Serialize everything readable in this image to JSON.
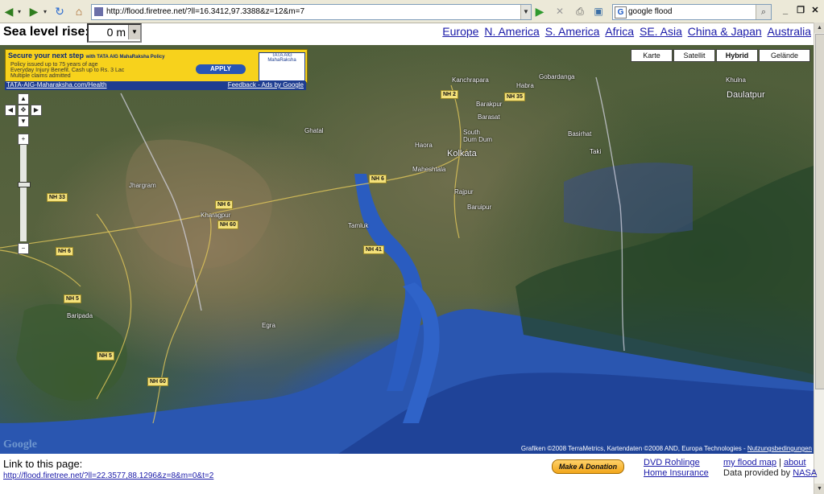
{
  "browser": {
    "url": "http://flood.firetree.net/?ll=16.3412,97.3388&z=12&m=7",
    "search_engine": "G",
    "search_query": "google flood",
    "icons": [
      "back-arrow-icon",
      "forward-arrow-icon",
      "dropdown-icon",
      "refresh-icon",
      "home-icon",
      "go-icon",
      "stop-icon",
      "print-icon",
      "screenshot-icon",
      "search-icon",
      "minimize-icon",
      "restore-icon",
      "close-icon"
    ]
  },
  "header": {
    "sea_level_label": "Sea level rise:",
    "sea_level_value": "0 m",
    "regions": [
      "Europe",
      "N. America",
      "S. America",
      "Africa",
      "SE. Asia",
      "China & Japan",
      "Australia"
    ]
  },
  "ad": {
    "headline": "Secure your next step",
    "headline_small": "with TATA AIG MahaRaksha Policy",
    "bullets": [
      "Policy issued up to 75 years of age",
      "Everyday Injury Benefit. Cash up to Rs. 3 Lac",
      "Multiple claims admitted"
    ],
    "apply": "APPLY",
    "logo": "TATA AIG MahaRaksha",
    "source_link": "TATA-AIG-Maharaksha.com/Health",
    "feedback": "Feedback - Ads by Google"
  },
  "map": {
    "map_types": [
      "Karte",
      "Satellit",
      "Hybrid",
      "Gelände"
    ],
    "active_type": "Hybrid",
    "copyright_text": "Grafiken ©2008 TerraMetrics, Kartendaten ©2008 AND, Europa Technologies -",
    "terms_link": "Nutzungsbedingungen",
    "logo": "Google",
    "zoom_level_fraction": 0.6,
    "places": [
      "Kanchrapara",
      "Habra",
      "Gobardanga",
      "Khulna",
      "Daulatpur",
      "Barakpur",
      "Barasat",
      "Ghatal",
      "Basirhat",
      "Taki",
      "South Dum Dum",
      "Haora",
      "Kolkata",
      "Maheshtala",
      "Rajpur",
      "Baruipur",
      "Jhargram",
      "Kharagpur",
      "Tamluk",
      "Egra",
      "Baripada"
    ],
    "roads": [
      "NH 2",
      "NH 35",
      "NH 6",
      "NH 33",
      "NH 6",
      "NH 60",
      "NH 6",
      "NH 41",
      "NH 5",
      "NH 5",
      "NH 60"
    ]
  },
  "footer": {
    "link_label": "Link to this page:",
    "link_url": "http://flood.firetree.net/?ll=22.3577,88.1296&z=8&m=0&t=2",
    "donate": "Make A Donation",
    "ad_links": [
      "DVD Rohlinge",
      "Home Insurance"
    ],
    "my_flood_map": "my flood map",
    "separator": "|",
    "about": "about",
    "data_by": "Data provided by",
    "nasa": "NASA"
  }
}
